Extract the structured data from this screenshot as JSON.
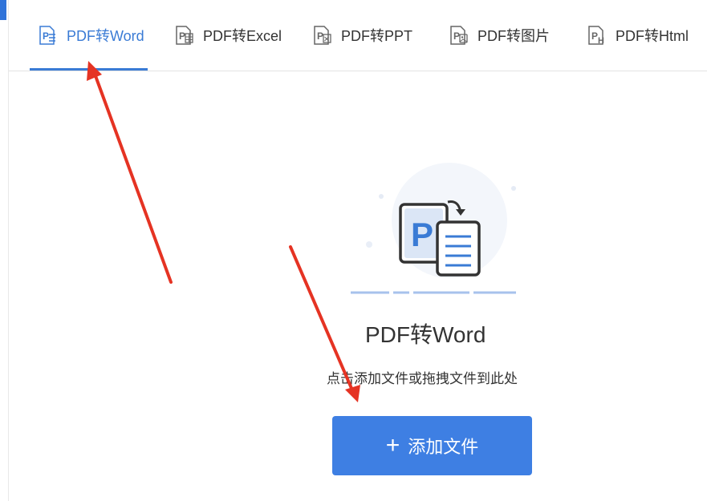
{
  "tabs": [
    {
      "label": "PDF转Word",
      "icon": "pdf-word-icon",
      "active": true
    },
    {
      "label": "PDF转Excel",
      "icon": "pdf-excel-icon",
      "active": false
    },
    {
      "label": "PDF转PPT",
      "icon": "pdf-ppt-icon",
      "active": false
    },
    {
      "label": "PDF转图片",
      "icon": "pdf-image-icon",
      "active": false
    },
    {
      "label": "PDF转Html",
      "icon": "pdf-html-icon",
      "active": false
    }
  ],
  "main": {
    "title": "PDF转Word",
    "hint": "点击添加文件或拖拽文件到此处",
    "add_button": {
      "plus": "+",
      "label": "添加文件"
    }
  },
  "colors": {
    "accent": "#3a7bd5",
    "button": "#3e7fe3",
    "annotation_arrow": "#e53323"
  }
}
